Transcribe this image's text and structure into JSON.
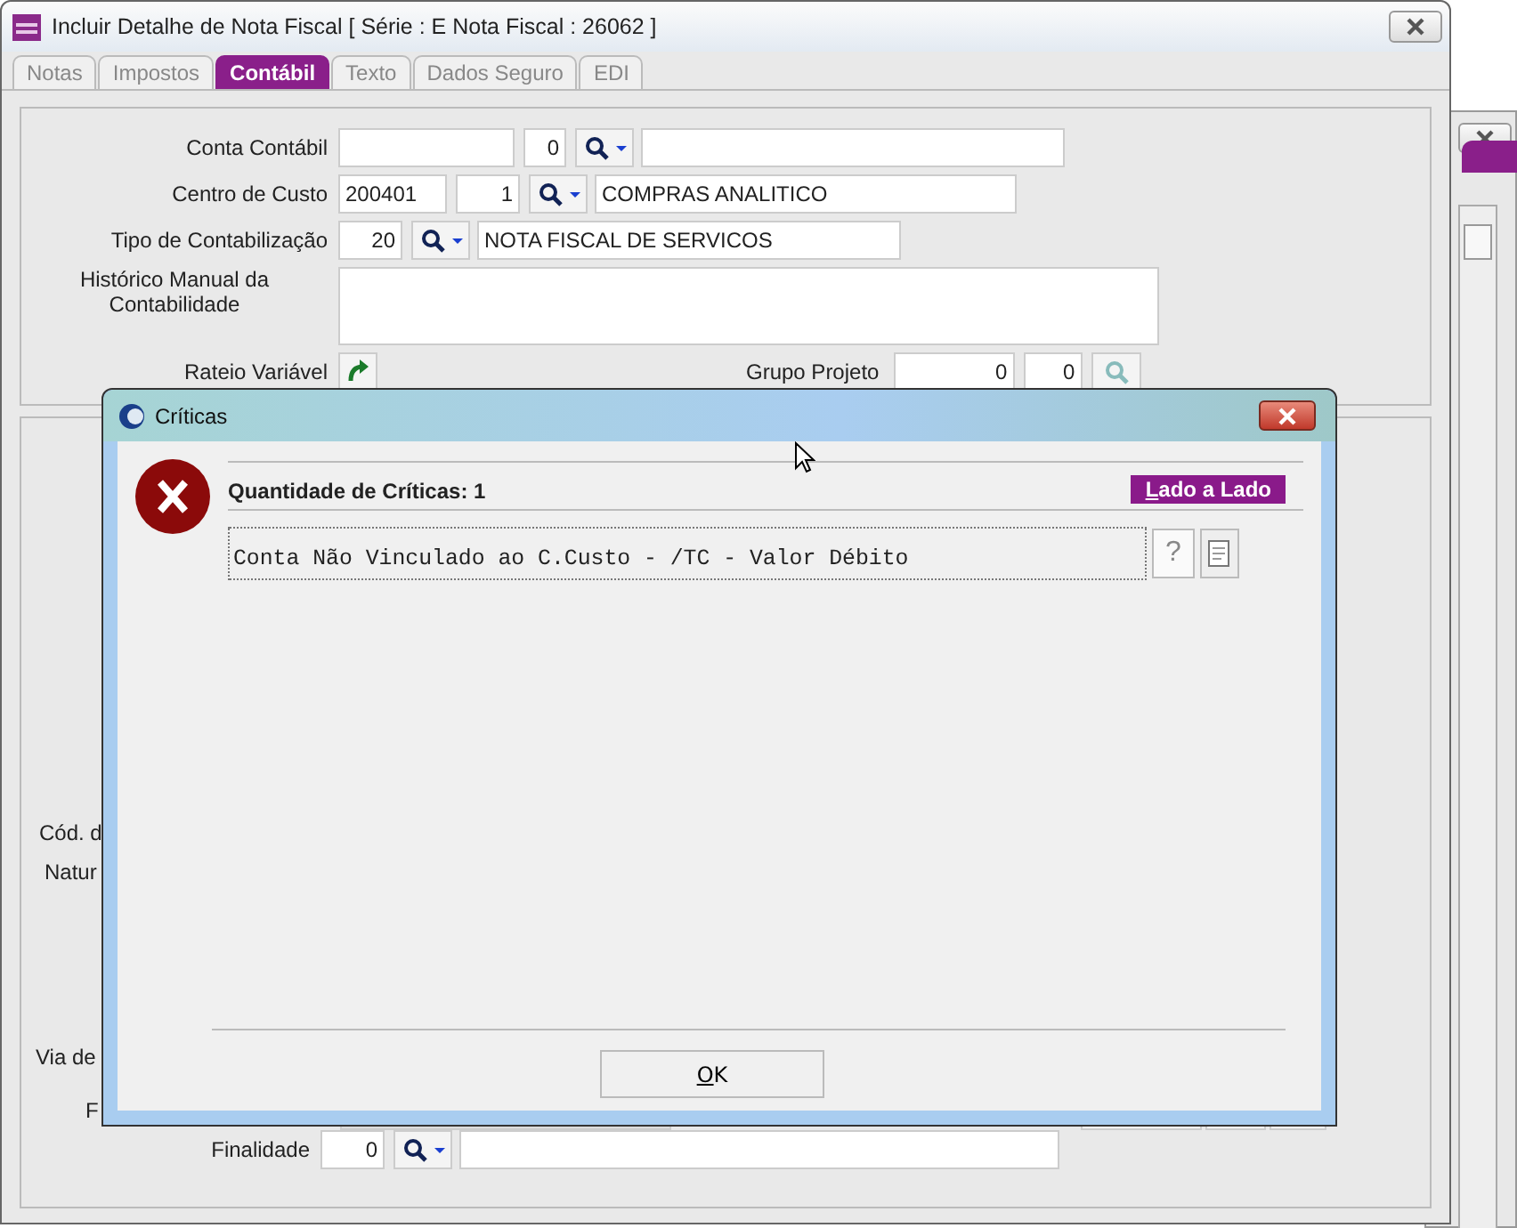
{
  "window": {
    "title": "Incluir Detalhe de Nota Fiscal [ Série : E   Nota Fiscal : 26062 ]"
  },
  "tabs": [
    {
      "label": "Notas",
      "selected": false
    },
    {
      "label": "Impostos",
      "selected": false
    },
    {
      "label": "Contábil",
      "selected": true
    },
    {
      "label": "Texto",
      "selected": false
    },
    {
      "label": "Dados Seguro",
      "selected": false
    },
    {
      "label": "EDI",
      "selected": false
    }
  ],
  "account_rows": [
    {
      "label": "Conta Contábil",
      "number": "0"
    },
    {
      "label": "Centro de Custo",
      "code": "200401",
      "number": "1",
      "description": "COMPRAS ANALITICO"
    },
    {
      "label": "Tipo de Contabilização",
      "number": "20",
      "description": "NOTA FISCAL DE SERVICOS"
    }
  ],
  "historico": {
    "label": "Histórico Manual da Contabilidade"
  },
  "rateio": {
    "label": "Rateio Variável"
  },
  "grupo_projeto": {
    "label": "Grupo Projeto",
    "values": [
      "0",
      "0"
    ]
  },
  "lower_labels": [
    "Cód. d",
    "Natur",
    "Via de",
    "F"
  ],
  "finalidade": {
    "label": "Finalidade",
    "number": "0"
  },
  "dialog": {
    "title": "Críticas",
    "count_label": "Quantidade de Críticas: 1",
    "side_button": "Lado a Lado",
    "messages": [
      {
        "text": "Conta Não Vinculado ao C.Custo - /TC - Valor Débito"
      }
    ],
    "help_button": "?",
    "ok_button": "OK"
  }
}
